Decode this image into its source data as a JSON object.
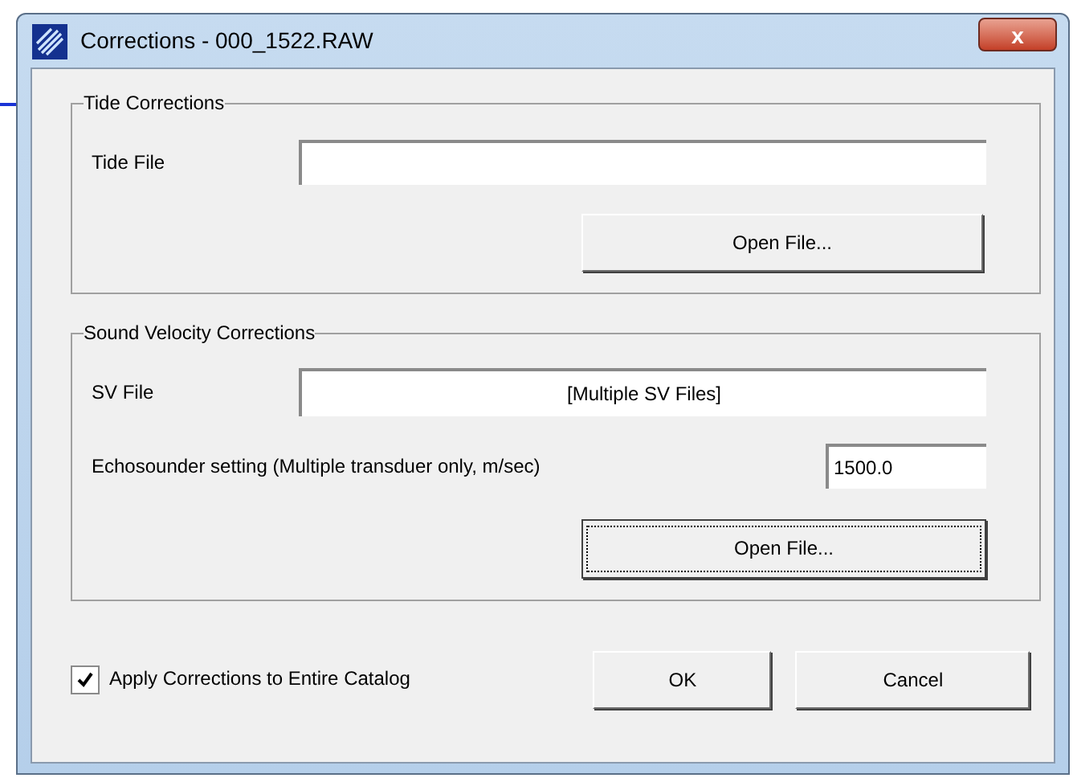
{
  "window": {
    "title": "Corrections - 000_1522.RAW",
    "close_label": "x"
  },
  "tide_group": {
    "legend": "Tide Corrections",
    "file_label": "Tide File",
    "button": "Open File..."
  },
  "sv_group": {
    "legend": "Sound Velocity Corrections",
    "file_label": "SV File",
    "file_value": "[Multiple SV Files]",
    "setting_label": "Echosounder setting (Multiple transduer only, m/sec)",
    "setting_value": "1500.0",
    "button": "Open File...",
    "button_focused": true
  },
  "apply_all": {
    "label": "Apply Corrections to Entire Catalog",
    "checked": true
  },
  "buttons": [
    "OK",
    "Cancel"
  ]
}
